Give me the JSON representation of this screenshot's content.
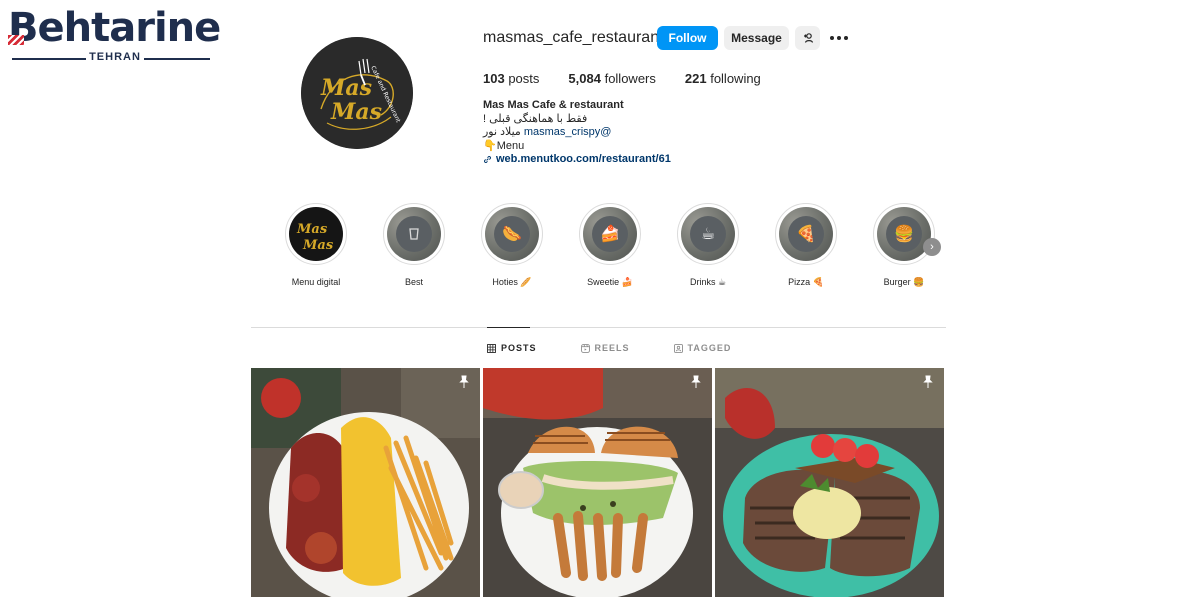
{
  "watermark": {
    "brand": "Behtarine",
    "city": "TEHRAN"
  },
  "profile": {
    "username": "masmas_cafe_restaurant",
    "avatar_text": "Mas Mas",
    "avatar_ring_text": "Cafe and Restaurant",
    "follow_label": "Follow",
    "message_label": "Message",
    "add_user_icon": "add-user-icon",
    "more_icon": "more-options-icon",
    "stats": {
      "posts_count": "103",
      "posts_label": "posts",
      "followers_count": "5,084",
      "followers_label": "followers",
      "following_count": "221",
      "following_label": "following"
    },
    "bio": {
      "name": "Mas Mas Cafe & restaurant",
      "line1": "فقط با هماهنگی قبلی !",
      "line2_text": "میلاد نور",
      "line2_mention": "masmas_crispy@",
      "line3": "👇Menu",
      "link": "web.menutkoo.com/restaurant/61"
    }
  },
  "highlights": [
    {
      "label": "Menu digital"
    },
    {
      "label": "Best"
    },
    {
      "label": "Hoties 🥖"
    },
    {
      "label": "Sweetie 🍰"
    },
    {
      "label": "Drinks ☕"
    },
    {
      "label": "Pizza 🍕"
    },
    {
      "label": "Burger 🍔"
    }
  ],
  "tabs": [
    {
      "label": "POSTS",
      "icon": "grid-icon",
      "active": true
    },
    {
      "label": "REELS",
      "icon": "reels-icon",
      "active": false
    },
    {
      "label": "TAGGED",
      "icon": "tagged-icon",
      "active": false
    }
  ],
  "colors": {
    "follow_button": "#0095f6",
    "link": "#00376b",
    "text": "#262626",
    "muted": "#8e8e8e"
  }
}
